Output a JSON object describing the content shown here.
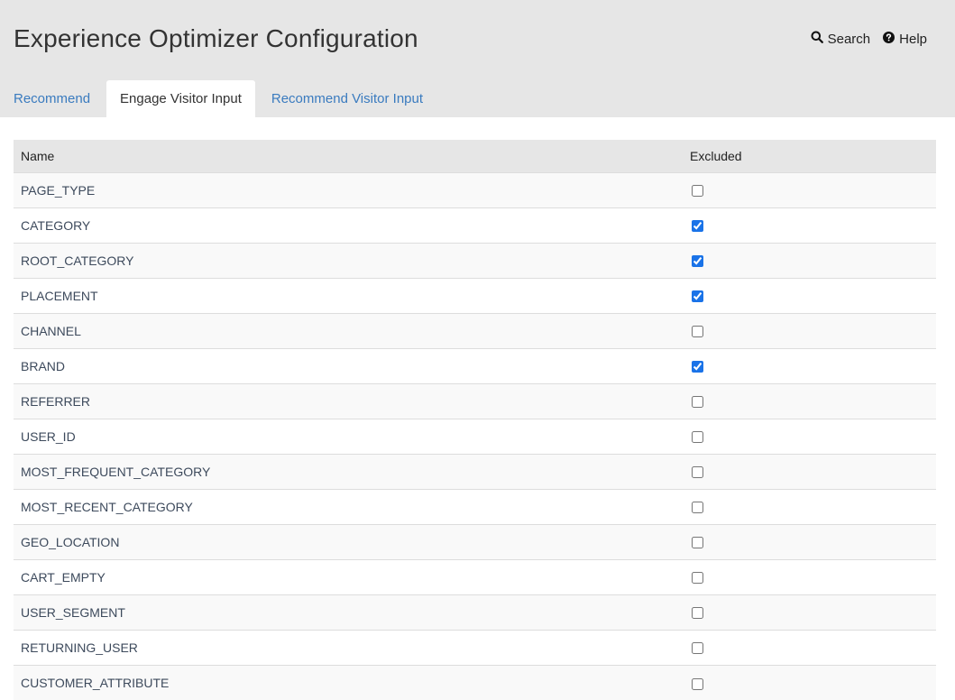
{
  "header": {
    "title": "Experience Optimizer Configuration",
    "search_label": "Search",
    "help_label": "Help"
  },
  "tabs": [
    {
      "label": "Recommend",
      "active": false
    },
    {
      "label": "Engage Visitor Input",
      "active": true
    },
    {
      "label": "Recommend Visitor Input",
      "active": false
    }
  ],
  "table": {
    "columns": [
      "Name",
      "Excluded"
    ],
    "rows": [
      {
        "name": "PAGE_TYPE",
        "excluded": false
      },
      {
        "name": "CATEGORY",
        "excluded": true
      },
      {
        "name": "ROOT_CATEGORY",
        "excluded": true
      },
      {
        "name": "PLACEMENT",
        "excluded": true
      },
      {
        "name": "CHANNEL",
        "excluded": false
      },
      {
        "name": "BRAND",
        "excluded": true
      },
      {
        "name": "REFERRER",
        "excluded": false
      },
      {
        "name": "USER_ID",
        "excluded": false
      },
      {
        "name": "MOST_FREQUENT_CATEGORY",
        "excluded": false
      },
      {
        "name": "MOST_RECENT_CATEGORY",
        "excluded": false
      },
      {
        "name": "GEO_LOCATION",
        "excluded": false
      },
      {
        "name": "CART_EMPTY",
        "excluded": false
      },
      {
        "name": "USER_SEGMENT",
        "excluded": false
      },
      {
        "name": "RETURNING_USER",
        "excluded": false
      },
      {
        "name": "CUSTOMER_ATTRIBUTE",
        "excluded": false
      }
    ]
  },
  "colors": {
    "accent": "#3a7bbf",
    "checkbox": "#1a73e8",
    "header_bg": "#e6e6e6"
  },
  "icons": {
    "search": "search-icon",
    "help": "question-circle-icon"
  }
}
